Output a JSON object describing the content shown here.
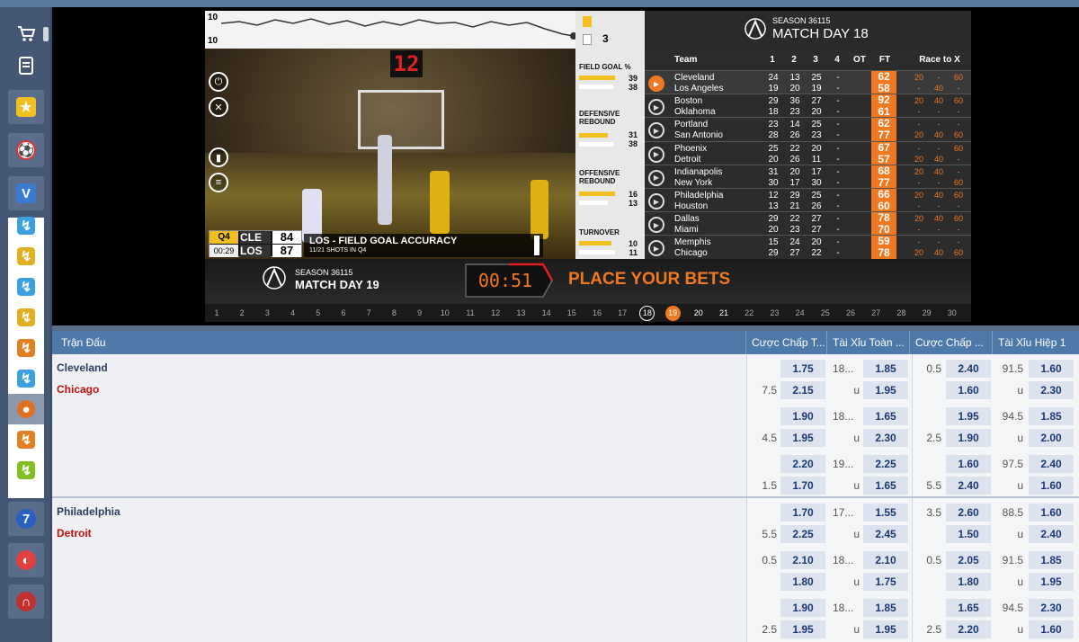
{
  "sidebar": {
    "items": [
      "cart-icon",
      "receipt-icon",
      "trophy-icon",
      "soccer-icon",
      "virtual-sports-icon"
    ],
    "sub_icons": [
      "sport-1",
      "sport-2",
      "sport-3",
      "sport-4",
      "sport-5",
      "sport-6",
      "basketball",
      "soccer-v",
      "sport-9"
    ],
    "bottom": [
      "lottery-icon",
      "globe-icon",
      "headset-icon"
    ]
  },
  "video": {
    "graph_top": "10",
    "graph_bottom": "10",
    "shot_clock": "12",
    "stat_top_value": "3",
    "stats": [
      {
        "title": "FIELD GOAL %",
        "a": "39",
        "b": "38"
      },
      {
        "title": "DEFENSIVE REBOUND",
        "a": "31",
        "b": "38"
      },
      {
        "title": "OFFENSIVE REBOUND",
        "a": "16",
        "b": "13"
      },
      {
        "title": "TURNOVER",
        "a": "10",
        "b": "11"
      }
    ],
    "scorebug": {
      "quarter": "Q4",
      "time": "00:29",
      "team1": "CLE",
      "score1": "84",
      "team2": "LOS",
      "score2": "87"
    },
    "banner_title": "LOS - FIELD GOAL ACCURACY",
    "banner_sub": "11/21 SHOTS IN Q4",
    "bottom_season": "SEASON 36115",
    "bottom_matchday": "MATCH DAY 19",
    "countdown": "00:51",
    "place_bets": "PLACE YOUR BETS",
    "days": [
      "1",
      "2",
      "3",
      "4",
      "5",
      "6",
      "7",
      "8",
      "9",
      "10",
      "11",
      "12",
      "13",
      "14",
      "15",
      "16",
      "17",
      "18",
      "19",
      "20",
      "21",
      "22",
      "23",
      "24",
      "25",
      "26",
      "27",
      "28",
      "29",
      "30"
    ]
  },
  "scoreboard": {
    "season": "SEASON 36115",
    "matchday": "MATCH DAY 18",
    "headers": [
      "Team",
      "1",
      "2",
      "3",
      "4",
      "OT",
      "FT",
      "Race to X"
    ],
    "games": [
      {
        "t1": "Cleveland",
        "t2": "Los Angeles",
        "q1": [
          "24",
          "13",
          "25",
          "-"
        ],
        "q2": [
          "19",
          "20",
          "19",
          "-"
        ],
        "ft1": "62",
        "ft2": "58",
        "r1": [
          "20",
          "-",
          "60"
        ],
        "r2": [
          "-",
          "40",
          "-"
        ]
      },
      {
        "t1": "Boston",
        "t2": "Oklahoma",
        "q1": [
          "29",
          "36",
          "27",
          "-"
        ],
        "q2": [
          "18",
          "23",
          "20",
          "-"
        ],
        "ft1": "92",
        "ft2": "61",
        "r1": [
          "20",
          "40",
          "60"
        ],
        "r2": [
          "-",
          "-",
          "-"
        ]
      },
      {
        "t1": "Portland",
        "t2": "San Antonio",
        "q1": [
          "23",
          "14",
          "25",
          "-"
        ],
        "q2": [
          "28",
          "26",
          "23",
          "-"
        ],
        "ft1": "62",
        "ft2": "77",
        "r1": [
          "-",
          "-",
          "-"
        ],
        "r2": [
          "20",
          "40",
          "60"
        ]
      },
      {
        "t1": "Phoenix",
        "t2": "Detroit",
        "q1": [
          "25",
          "22",
          "20",
          "-"
        ],
        "q2": [
          "20",
          "26",
          "11",
          "-"
        ],
        "ft1": "67",
        "ft2": "57",
        "r1": [
          "-",
          "-",
          "60"
        ],
        "r2": [
          "20",
          "40",
          "-"
        ]
      },
      {
        "t1": "Indianapolis",
        "t2": "New York",
        "q1": [
          "31",
          "20",
          "17",
          "-"
        ],
        "q2": [
          "30",
          "17",
          "30",
          "-"
        ],
        "ft1": "68",
        "ft2": "77",
        "r1": [
          "20",
          "40",
          "-"
        ],
        "r2": [
          "-",
          "-",
          "60"
        ]
      },
      {
        "t1": "Philadelphia",
        "t2": "Houston",
        "q1": [
          "12",
          "29",
          "25",
          "-"
        ],
        "q2": [
          "13",
          "21",
          "26",
          "-"
        ],
        "ft1": "66",
        "ft2": "60",
        "r1": [
          "20",
          "40",
          "60"
        ],
        "r2": [
          "-",
          "-",
          "-"
        ]
      },
      {
        "t1": "Dallas",
        "t2": "Miami",
        "q1": [
          "29",
          "22",
          "27",
          "-"
        ],
        "q2": [
          "20",
          "23",
          "27",
          "-"
        ],
        "ft1": "78",
        "ft2": "70",
        "r1": [
          "20",
          "40",
          "60"
        ],
        "r2": [
          "-",
          "-",
          "-"
        ]
      },
      {
        "t1": "Memphis",
        "t2": "Chicago",
        "q1": [
          "15",
          "24",
          "20",
          "-"
        ],
        "q2": [
          "29",
          "27",
          "22",
          "-"
        ],
        "ft1": "59",
        "ft2": "78",
        "r1": [
          "-",
          "-",
          "-"
        ],
        "r2": [
          "20",
          "40",
          "60"
        ]
      }
    ]
  },
  "bets": {
    "headers": [
      "Trận Đấu",
      "Cược Chấp T...",
      "Tài Xỉu Toàn ...",
      "Cược Chấp ...",
      "Tài Xỉu Hiệp 1"
    ],
    "matches": [
      {
        "team1": "Cleveland",
        "team2": "Chicago",
        "lines": [
          {
            "hc1": "",
            "o1": "1.75",
            "ou1": "18...",
            "o2": "1.85",
            "hc2": "0.5",
            "o3": "2.40",
            "ou2": "91.5",
            "o4": "1.60"
          },
          {
            "hc1": "7.5",
            "o1": "2.15",
            "ou1": "u",
            "o2": "1.95",
            "hc2": "",
            "o3": "1.60",
            "ou2": "u",
            "o4": "2.30"
          },
          {
            "hc1": "",
            "o1": "1.90",
            "ou1": "18...",
            "o2": "1.65",
            "hc2": "",
            "o3": "1.95",
            "ou2": "94.5",
            "o4": "1.85"
          },
          {
            "hc1": "4.5",
            "o1": "1.95",
            "ou1": "u",
            "o2": "2.30",
            "hc2": "2.5",
            "o3": "1.90",
            "ou2": "u",
            "o4": "2.00"
          },
          {
            "hc1": "",
            "o1": "2.20",
            "ou1": "19...",
            "o2": "2.25",
            "hc2": "",
            "o3": "1.60",
            "ou2": "97.5",
            "o4": "2.40"
          },
          {
            "hc1": "1.5",
            "o1": "1.70",
            "ou1": "u",
            "o2": "1.65",
            "hc2": "5.5",
            "o3": "2.40",
            "ou2": "u",
            "o4": "1.60"
          }
        ]
      },
      {
        "team1": "Philadelphia",
        "team2": "Detroit",
        "lines": [
          {
            "hc1": "",
            "o1": "1.70",
            "ou1": "17...",
            "o2": "1.55",
            "hc2": "3.5",
            "o3": "2.60",
            "ou2": "88.5",
            "o4": "1.60"
          },
          {
            "hc1": "5.5",
            "o1": "2.25",
            "ou1": "u",
            "o2": "2.45",
            "hc2": "",
            "o3": "1.50",
            "ou2": "u",
            "o4": "2.40"
          },
          {
            "hc1": "0.5",
            "o1": "2.10",
            "ou1": "18...",
            "o2": "2.10",
            "hc2": "0.5",
            "o3": "2.05",
            "ou2": "91.5",
            "o4": "1.85"
          },
          {
            "hc1": "",
            "o1": "1.80",
            "ou1": "u",
            "o2": "1.75",
            "hc2": "",
            "o3": "1.80",
            "ou2": "u",
            "o4": "1.95"
          },
          {
            "hc1": "",
            "o1": "1.90",
            "ou1": "18...",
            "o2": "1.85",
            "hc2": "",
            "o3": "1.65",
            "ou2": "94.5",
            "o4": "2.30"
          },
          {
            "hc1": "2.5",
            "o1": "1.95",
            "ou1": "u",
            "o2": "1.95",
            "hc2": "2.5",
            "o3": "2.20",
            "ou2": "u",
            "o4": "1.60"
          }
        ]
      }
    ]
  },
  "colors": {
    "accent": "#f07820",
    "header": "#4d7aa8",
    "sidebar": "#445775",
    "team_red": "#c01010",
    "team_blue": "#2c3e60"
  }
}
